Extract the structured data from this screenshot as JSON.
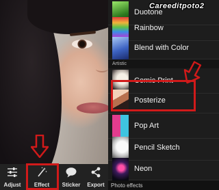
{
  "watermark": "Careeditpoto2",
  "toolbar": {
    "tools": [
      {
        "label": "Adjust",
        "icon": "sliders-icon"
      },
      {
        "label": "Effect",
        "icon": "magic-wand-icon"
      },
      {
        "label": "Sticker",
        "icon": "speech-bubble-icon"
      },
      {
        "label": "Export",
        "icon": "share-icon"
      }
    ],
    "selected": "Effect"
  },
  "effects": {
    "items_top": [
      "Duotone",
      "Rainbow",
      "Blend with Color"
    ],
    "section_artistic": "Artistic",
    "items_artistic": [
      "Comic Print",
      "Posterize",
      "Pop Art",
      "Pencil Sketch",
      "Neon"
    ],
    "footer": "Photo effects",
    "highlighted": "Posterize"
  },
  "colors": {
    "callout": "#d11a1a",
    "panel_bg": "#1d1d1d"
  }
}
